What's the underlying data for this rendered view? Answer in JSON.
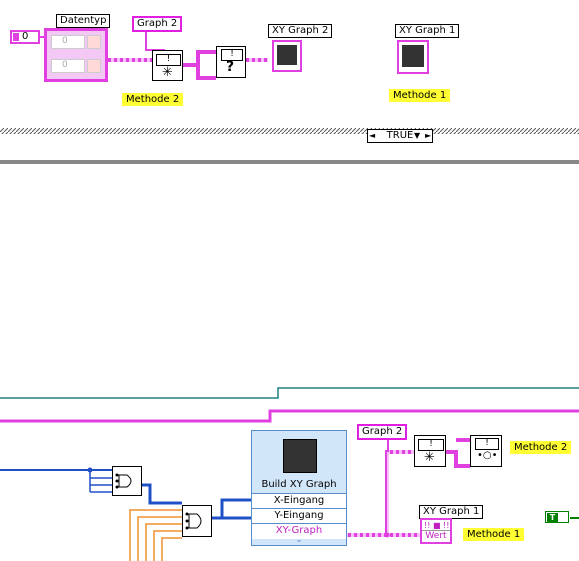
{
  "labels": {
    "datentyp": "Datentyp",
    "graph2_top": "Graph 2",
    "xy_graph2": "XY Graph 2",
    "xy_graph1_top": "XY Graph 1",
    "graph2_bottom": "Graph 2",
    "xy_graph1_bottom": "XY Graph 1"
  },
  "notes": {
    "methode2_top": "Methode 2",
    "methode1_top": "Methode 1",
    "methode2_bottom": "Methode 2",
    "methode1_bottom": "Methode 1"
  },
  "constants": {
    "numeric_zero": "0",
    "cluster_a": "0",
    "cluster_b": "0",
    "bool_true": "T"
  },
  "case_selector": {
    "value": "TRUE",
    "left_arrow": "◄",
    "dropdown_arrow": "▼",
    "right_arrow": "►"
  },
  "build_xy_graph": {
    "title": "Build XY Graph",
    "x_input": "X-Eingang",
    "y_input": "Y-Eingang",
    "output": "XY-Graph",
    "expand": "⌄"
  },
  "property_node": {
    "wert": "Wert"
  },
  "colors": {
    "cluster_wire": "#e040e0",
    "numeric_wire": "#2050c8",
    "orange_wire": "#f09030",
    "teal_wire": "#208080",
    "comment_bg": "#ffff33",
    "express_vi": "#d2e6fa"
  }
}
